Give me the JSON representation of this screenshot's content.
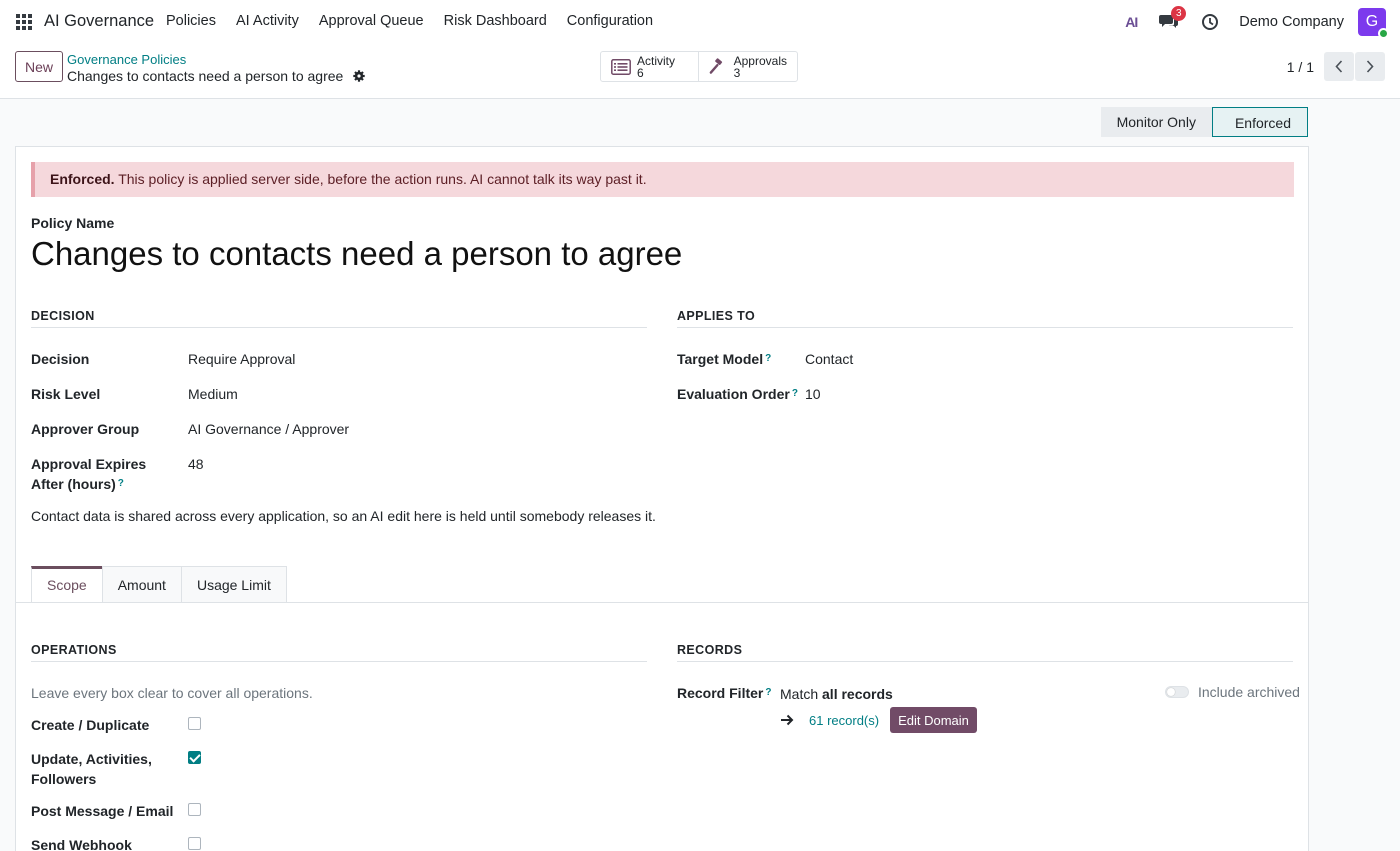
{
  "nav": {
    "brand": "AI Governance",
    "items": [
      "Policies",
      "AI Activity",
      "Approval Queue",
      "Risk Dashboard",
      "Configuration"
    ],
    "ai_logo": "AI",
    "messages_count": "3",
    "company": "Demo Company",
    "avatar_initial": "G"
  },
  "control": {
    "new_label": "New",
    "breadcrumb_parent": "Governance Policies",
    "breadcrumb_current": "Changes to contacts need a person to agree",
    "smart_buttons": [
      {
        "label": "Activity",
        "count": "6"
      },
      {
        "label": "Approvals",
        "count": "3"
      }
    ],
    "pager": "1 / 1"
  },
  "status": {
    "stages": [
      "Monitor Only",
      "Enforced"
    ],
    "active": "Enforced"
  },
  "alert": {
    "strong": "Enforced.",
    "text": " This policy is applied server side, before the action runs. AI cannot talk its way past it."
  },
  "policy": {
    "name_label": "Policy Name",
    "name": "Changes to contacts need a person to agree"
  },
  "decision": {
    "heading": "DECISION",
    "fields": [
      {
        "label": "Decision",
        "value": "Require Approval"
      },
      {
        "label": "Risk Level",
        "value": "Medium"
      },
      {
        "label": "Approver Group",
        "value": "AI Governance / Approver"
      },
      {
        "label": "Approval Expires After (hours)",
        "value": "48"
      }
    ],
    "note": "Contact data is shared across every application, so an AI edit here is held until somebody releases it."
  },
  "applies_to": {
    "heading": "APPLIES TO",
    "fields": [
      {
        "label": "Target Model",
        "value": "Contact"
      },
      {
        "label": "Evaluation Order",
        "value": "10"
      }
    ]
  },
  "tabs": [
    "Scope",
    "Amount",
    "Usage Limit"
  ],
  "operations": {
    "heading": "OPERATIONS",
    "hint": "Leave every box clear to cover all operations.",
    "items": [
      {
        "label": "Create / Duplicate",
        "checked": false
      },
      {
        "label": "Update, Activities, Followers",
        "checked": true
      },
      {
        "label": "Post Message / Email",
        "checked": false
      },
      {
        "label": "Send Webhook",
        "checked": false
      }
    ]
  },
  "records": {
    "heading": "RECORDS",
    "filter_label": "Record Filter",
    "match_prefix": "Match ",
    "match_strong": "all records",
    "include_archived": "Include archived",
    "count_link": "61 record(s)",
    "edit_domain": "Edit Domain"
  },
  "colors": {
    "accent": "#017e84",
    "brand": "#714b67",
    "alert_bg": "#f5d8dc"
  }
}
